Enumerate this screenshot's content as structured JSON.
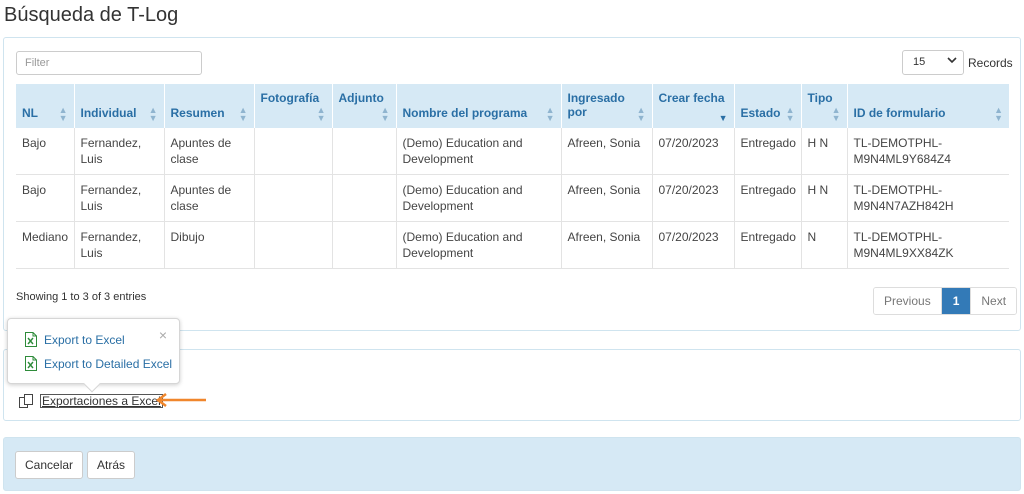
{
  "page": {
    "title": "Búsqueda de T-Log"
  },
  "toolbar": {
    "filter_placeholder": "Filter",
    "records_value": "15",
    "records_label": "Records"
  },
  "table": {
    "headers": [
      {
        "label": "NL",
        "sortable": true
      },
      {
        "label": "Individual",
        "sortable": true
      },
      {
        "label": "Resumen",
        "sortable": true
      },
      {
        "label": "Fotografía",
        "sortable": true
      },
      {
        "label": "Adjunto",
        "sortable": true
      },
      {
        "label": "Nombre del programa",
        "sortable": true
      },
      {
        "label": "Ingresado por",
        "sortable": true
      },
      {
        "label": "Crear fecha",
        "sortable": true,
        "sorted": "desc"
      },
      {
        "label": "Estado",
        "sortable": true
      },
      {
        "label": "Tipo",
        "sortable": true
      },
      {
        "label": "ID de formulario",
        "sortable": true
      }
    ],
    "rows": [
      [
        "Bajo",
        "Fernandez, Luis",
        "Apuntes de clase",
        "",
        "",
        "(Demo) Education and Development",
        "Afreen, Sonia",
        "07/20/2023",
        "Entregado",
        "H N",
        "TL-DEMOTPHL-M9N4ML9Y684Z4"
      ],
      [
        "Bajo",
        "Fernandez, Luis",
        "Apuntes de clase",
        "",
        "",
        "(Demo) Education and Development",
        "Afreen, Sonia",
        "07/20/2023",
        "Entregado",
        "H N",
        "TL-DEMOTPHL-M9N4N7AZH842H"
      ],
      [
        "Mediano",
        "Fernandez, Luis",
        "Dibujo",
        "",
        "",
        "(Demo) Education and Development",
        "Afreen, Sonia",
        "07/20/2023",
        "Entregado",
        "N",
        "TL-DEMOTPHL-M9N4ML9XX84ZK"
      ]
    ]
  },
  "footer": {
    "showing": "Showing 1 to 3 of 3 entries",
    "pager": {
      "previous": "Previous",
      "current": "1",
      "next": "Next"
    }
  },
  "popover": {
    "close": "×",
    "items": [
      "Export to Excel",
      "Export to Detailed Excel"
    ]
  },
  "export": {
    "link_label": "Exportaciones a Excel"
  },
  "actions": {
    "cancel": "Cancelar",
    "back": "Atrás"
  },
  "colors": {
    "header_bg": "#d6e9f5",
    "header_text": "#2a6fa5",
    "accent": "#337ab7",
    "arrow": "#f0862c",
    "excel_green": "#2e8b3a"
  }
}
